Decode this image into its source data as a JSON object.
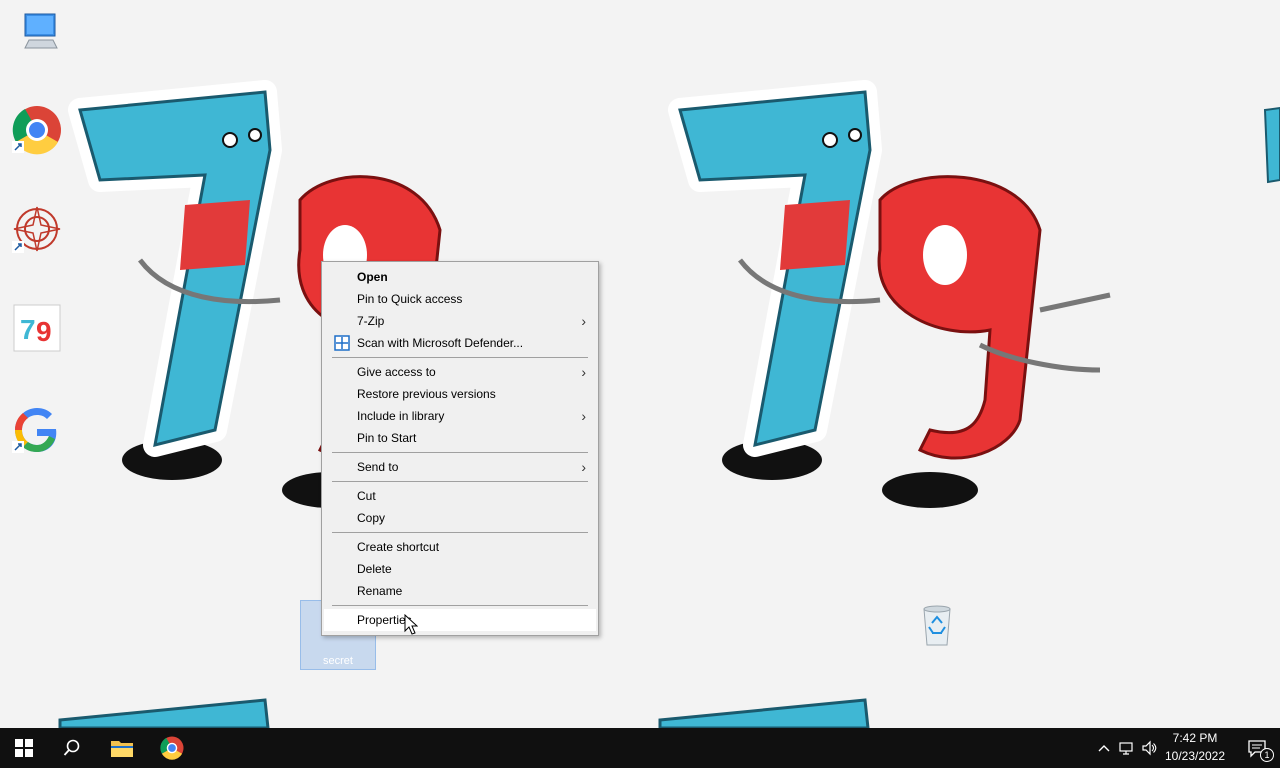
{
  "desktop": {
    "icons": [
      {
        "name": "this-pc-icon"
      },
      {
        "name": "chrome-shortcut-icon"
      },
      {
        "name": "mandala-shortcut-icon"
      },
      {
        "name": "79-app-icon"
      },
      {
        "name": "google-shortcut-icon"
      },
      {
        "name": "recycle-bin-icon"
      }
    ],
    "selected_file": {
      "label": "secret"
    }
  },
  "context_menu": {
    "items": [
      {
        "label": "Open"
      },
      {
        "label": "Pin to Quick access"
      },
      {
        "label": "7-Zip"
      },
      {
        "label": "Scan with Microsoft Defender..."
      },
      {
        "label": "Give access to"
      },
      {
        "label": "Restore previous versions"
      },
      {
        "label": "Include in library"
      },
      {
        "label": "Pin to Start"
      },
      {
        "label": "Send to"
      },
      {
        "label": "Cut"
      },
      {
        "label": "Copy"
      },
      {
        "label": "Create shortcut"
      },
      {
        "label": "Delete"
      },
      {
        "label": "Rename"
      },
      {
        "label": "Properties"
      }
    ],
    "submenu_arrow": "›"
  },
  "taskbar": {
    "time": "7:42 PM",
    "date": "10/23/2022",
    "notification_count": "1"
  },
  "colors": {
    "taskbar": "#101010",
    "menu_bg": "#f0f0f0",
    "accent": "#0078d7"
  }
}
